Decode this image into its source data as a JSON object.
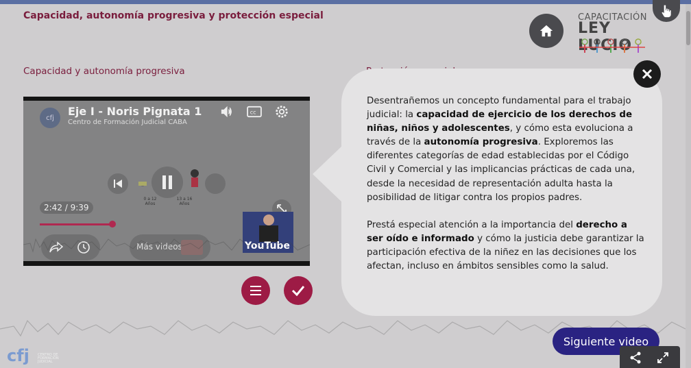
{
  "header": {
    "title": "Capacidad, autonomía progresiva y protección especial"
  },
  "sections": {
    "left_title": "Capacidad y autonomía progresiva",
    "right_title": "Protección especial"
  },
  "logo": {
    "line1": "CAPACITACIÓN",
    "line2": "LEY LUCIO"
  },
  "video": {
    "title": "Eje I - Noris Pignata 1",
    "channel": "Centro de Formación Judicial CABA",
    "channel_initials": "cfj",
    "time": "2:42 / 9:39",
    "progress": 0.28,
    "more_label": "Más videos",
    "youtube_label": "YouTube",
    "age_label_1": "0 a 12 Años",
    "age_label_2": "13 a 16 Años"
  },
  "popup": {
    "p1": [
      {
        "t": "Desentrañemos un concepto fundamental para el trabajo judicial: la ",
        "b": false
      },
      {
        "t": "capacidad de ejercicio de los derechos de niñas, niños y adolescentes",
        "b": true
      },
      {
        "t": ", y cómo esta evoluciona a través de la ",
        "b": false
      },
      {
        "t": "autonomía progresiva",
        "b": true
      },
      {
        "t": ". Exploremos las diferentes categorías de edad establecidas por el Código Civil y Comercial y las implicancias prácticas de cada una, desde la necesidad de representación adulta hasta la posibilidad de litigar contra los propios padres.",
        "b": false
      }
    ],
    "p2": [
      {
        "t": "Prestá especial atención a la importancia del ",
        "b": false
      },
      {
        "t": "derecho a ser oído e informado",
        "b": true
      },
      {
        "t": " y cómo la justicia debe garantizar la participación efectiva de la niñez en las decisiones que los afectan, incluso en ámbitos sensibles como la salud.",
        "b": false
      }
    ]
  },
  "buttons": {
    "next_label": "Siguiente video"
  },
  "footer": {
    "logo_text": "cfj",
    "logo_sub": "CENTRO DE FORMACIÓN JUDICIAL"
  },
  "colors": {
    "accent": "#9d1b45",
    "next_button": "#2a2382",
    "title_text": "#7a1d3d"
  },
  "icons": [
    "home-icon",
    "hand-pointer-icon",
    "close-icon",
    "menu-icon",
    "check-icon",
    "share-icon",
    "fullscreen-icon",
    "volume-icon",
    "cc-icon",
    "settings-icon",
    "pause-icon",
    "prev-icon",
    "clock-icon",
    "expand-icon"
  ]
}
